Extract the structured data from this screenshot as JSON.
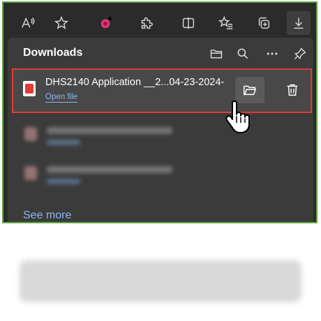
{
  "toolbar": {
    "buttons": [
      {
        "name": "read-aloud-icon",
        "label": "Â"
      },
      {
        "name": "favorite-star-icon"
      },
      {
        "name": "extension-badge-icon"
      },
      {
        "name": "puzzle-extensions-icon"
      },
      {
        "name": "split-screen-icon"
      },
      {
        "name": "favorites-list-icon"
      },
      {
        "name": "collections-icon"
      },
      {
        "name": "downloads-arrow-icon"
      }
    ]
  },
  "downloads": {
    "title": "Downloads",
    "header_icons": [
      "open-folder-icon",
      "search-icon",
      "more-options-icon",
      "pin-icon"
    ],
    "item": {
      "file_name": "DHS2140 Application __2...04-23-2024-",
      "open_label": "Open file",
      "file_icon": "pdf-file-icon"
    },
    "see_more": "See more"
  },
  "colors": {
    "highlight_border": "#e23b3b",
    "frame_border": "#5aa63c",
    "link": "#8bb7f0",
    "panel_bg": "#3b3b3b"
  }
}
